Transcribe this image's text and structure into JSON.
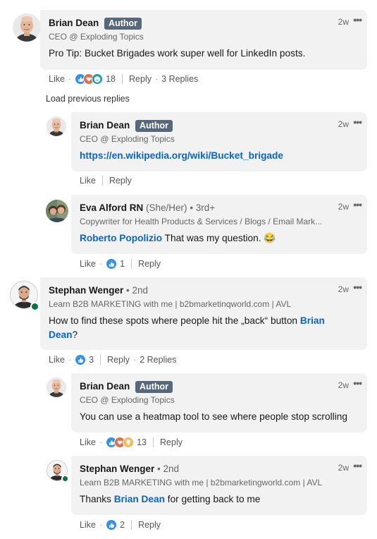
{
  "comments": [
    {
      "author": "Brian Dean",
      "badge": "Author",
      "degree": "",
      "pronouns": "",
      "headline": "CEO @ Exploding Topics",
      "text": "Pro Tip: Bucket Brigades work super well for LinkedIn posts.",
      "time": "2w",
      "actions": {
        "like": "Like",
        "reactions": "18",
        "reply": "Reply",
        "replies": "3 Replies"
      }
    },
    {
      "author": "Brian Dean",
      "badge": "Author",
      "headline": "CEO @ Exploding Topics",
      "link": "https://en.wikipedia.org/wiki/Bucket_brigade",
      "time": "2w",
      "actions": {
        "like": "Like",
        "reply": "Reply"
      }
    },
    {
      "author": "Eva Alford RN",
      "pronouns": "(She/Her)",
      "degree": "• 3rd+",
      "headline": "Copywriter for Health Products & Services / Blogs / Email Mark...",
      "mention": "Roberto Popolizio",
      "text": " That was my question. 😂",
      "time": "2w",
      "actions": {
        "like": "Like",
        "reactions": "1",
        "reply": "Reply"
      }
    },
    {
      "author": "Stephan Wenger",
      "degree": "• 2nd",
      "headline": "Learn B2B MARKETING with me | b2bmarketinqworld.com | AVL",
      "text_line1_before": "How to find these spots where people hit the „back“ button ",
      "mention_part1": "Brian",
      "mention_part2": "Dean",
      "text_line2_after": "?",
      "time": "2w",
      "actions": {
        "like": "Like",
        "reactions": "3",
        "reply": "Reply",
        "replies": "2 Replies"
      }
    },
    {
      "author": "Brian Dean",
      "badge": "Author",
      "headline": "CEO @ Exploding Topics",
      "text": "You can use a heatmap tool to see where people stop scrolling",
      "time": "2w",
      "actions": {
        "like": "Like",
        "reactions": "13",
        "reply": "Reply"
      }
    },
    {
      "author": "Stephan Wenger",
      "degree": "• 2nd",
      "headline": "Learn B2B MARKETING with me | b2bmarketingworld.com | AVL",
      "text_before": "Thanks ",
      "mention": "Brian Dean",
      "text_after": " for getting back to me",
      "time": "2w",
      "actions": {
        "like": "Like",
        "reactions": "2",
        "reply": "Reply"
      }
    }
  ],
  "load_previous": "Load previous replies",
  "more_icon": "more-horizontal-icon",
  "colors": {
    "bubble": "#f2f2f2",
    "link": "#0a66c2",
    "badge": "#56687a",
    "like": "#378fe9",
    "love": "#df704d",
    "celebrate": "#44712e",
    "insightful": "#f5bb5c",
    "presence": "#057642"
  }
}
